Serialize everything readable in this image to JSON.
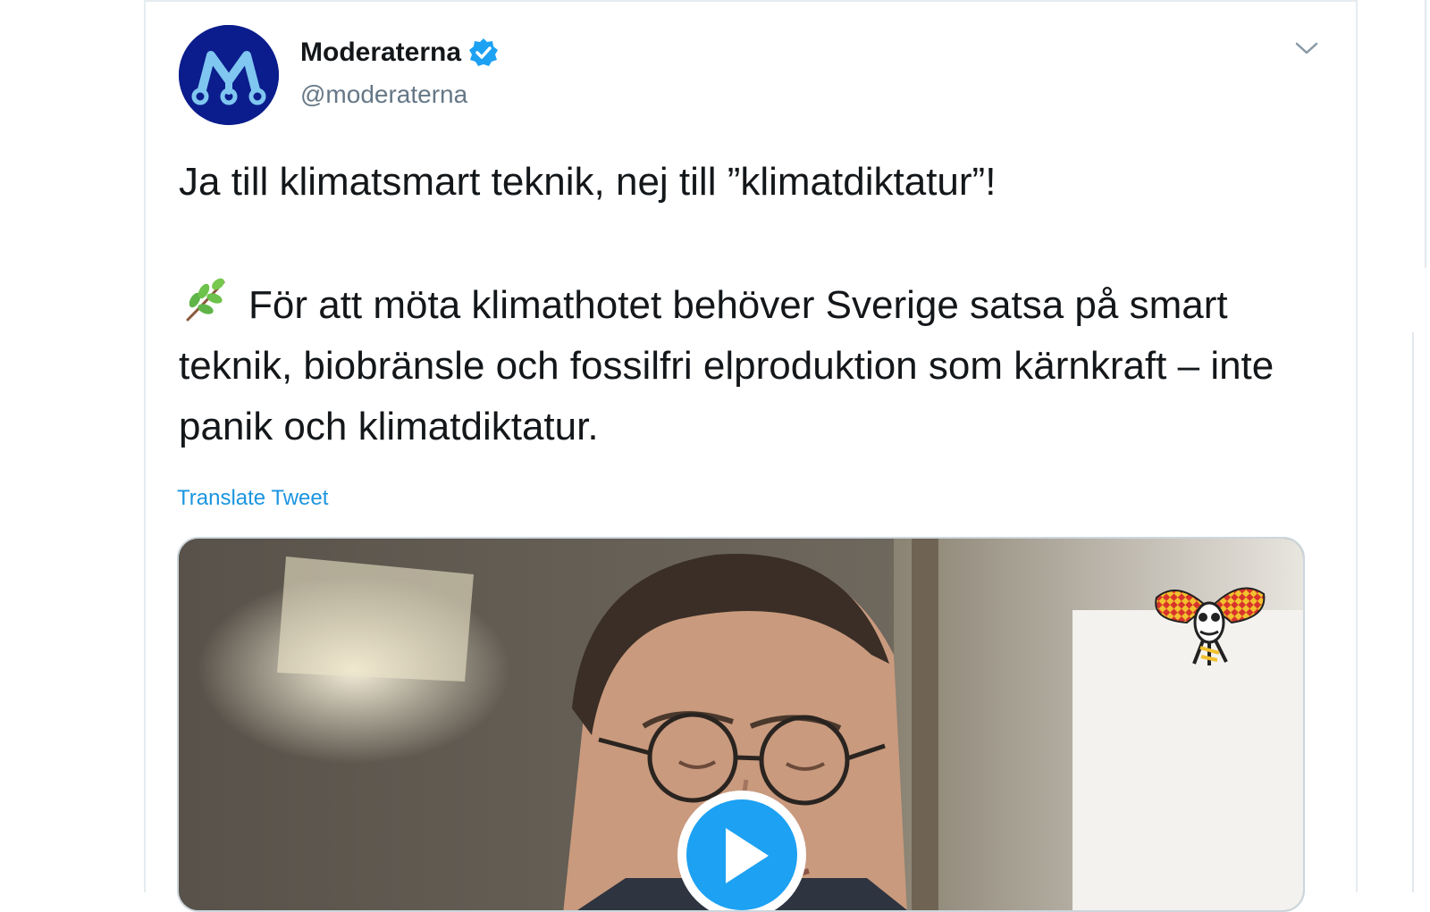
{
  "tweet": {
    "display_name": "Moderaterna",
    "handle": "@moderaterna",
    "verified": true,
    "text_line1": "Ja till klimatsmart teknik, nej till ”klimatdiktatur”!",
    "text_paragraph2": "För att möta klimathotet behöver Sverige satsa på smart teknik, biobränsle och fossilfri elproduktion som kärnkraft – inte panik och klimatdiktatur.",
    "emoji_icon": "herb-icon",
    "translate_label": "Translate Tweet",
    "media_type": "video"
  },
  "colors": {
    "link_blue": "#1b95e0",
    "verified_blue": "#1da1f2",
    "avatar_navy": "#0b1d8c",
    "handle_gray": "#657786"
  },
  "icons": {
    "avatar": "moderaterna-logo-icon",
    "verified": "verified-badge-icon",
    "caret": "chevron-down-icon",
    "play": "play-icon",
    "watermark": "wasp-logo-icon"
  }
}
